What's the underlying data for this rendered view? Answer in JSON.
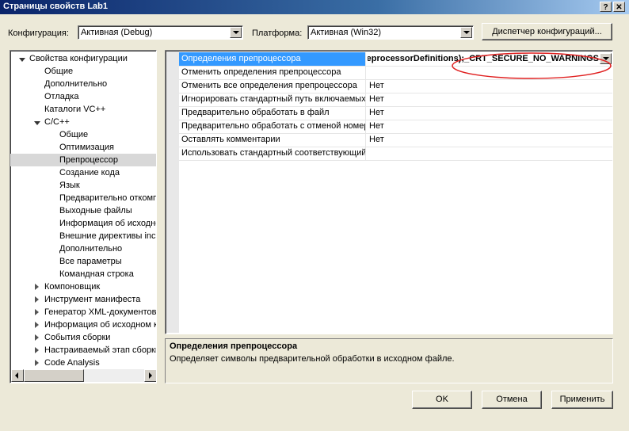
{
  "window": {
    "title": "Страницы свойств Lab1",
    "help_label": "?",
    "close_label": "✕"
  },
  "config": {
    "config_label": "Конфигурация:",
    "config_value": "Активная (Debug)",
    "platform_label": "Платформа:",
    "platform_value": "Активная (Win32)",
    "manager_button": "Диспетчер конфигураций..."
  },
  "tree": {
    "root": "Свойства конфигурации",
    "general": "Общие",
    "advanced": "Дополнительно",
    "debugging": "Отладка",
    "vc_dirs": "Каталоги VC++",
    "cpp": "C/C++",
    "cpp_children": [
      "Общие",
      "Оптимизация",
      "Препроцессор",
      "Создание кода",
      "Язык",
      "Предварительно откомп",
      "Выходные файлы",
      "Информация об исходно",
      "Внешние директивы inc",
      "Дополнительно",
      "Все параметры",
      "Командная строка"
    ],
    "after": [
      "Компоновщик",
      "Инструмент манифеста",
      "Генератор XML-документов",
      "Информация об исходном к",
      "События сборки",
      "Настраиваемый этап сборки",
      "Code Analysis"
    ]
  },
  "props": [
    {
      "name": "Определения препроцессора",
      "value": "reprocessorDefinitions);_CRT_SECURE_NO_WARNINGS"
    },
    {
      "name": "Отменить определения препроцессора",
      "value": ""
    },
    {
      "name": "Отменить все определения препроцессора",
      "value": "Нет"
    },
    {
      "name": "Игнорировать стандартный путь включаемых",
      "value": "Нет"
    },
    {
      "name": "Предварительно обработать в файл",
      "value": "Нет"
    },
    {
      "name": "Предварительно обработать с отменой номеров",
      "value": "Нет"
    },
    {
      "name": "Оставлять комментарии",
      "value": "Нет"
    },
    {
      "name": "Использовать стандартный соответствующий",
      "value": ""
    }
  ],
  "description": {
    "title": "Определения препроцессора",
    "text": "Определяет символы предварительной обработки в исходном файле."
  },
  "buttons": {
    "ok": "OK",
    "cancel": "Отмена",
    "apply": "Применить"
  }
}
